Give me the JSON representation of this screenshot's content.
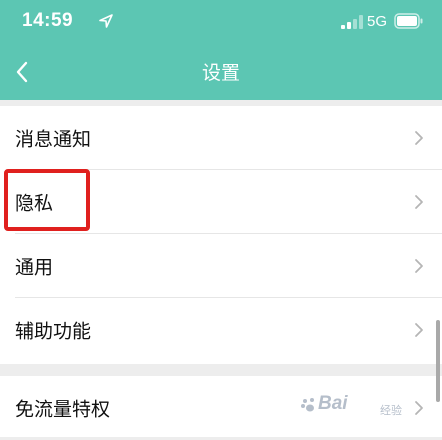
{
  "status_bar": {
    "time": "14:59",
    "network": "5G",
    "icons": [
      "location-arrow-icon",
      "signal-icon",
      "battery-icon"
    ]
  },
  "nav": {
    "title": "设置",
    "back_icon": "chevron-left-icon"
  },
  "settings": {
    "group1": [
      {
        "label": "消息通知"
      },
      {
        "label": "隐私"
      },
      {
        "label": "通用"
      },
      {
        "label": "辅助功能"
      }
    ],
    "group2": [
      {
        "label": "免流量特权"
      }
    ]
  },
  "watermark": {
    "text": "Bai",
    "sub": "经验"
  },
  "colors": {
    "header": "#5cc6b3",
    "highlight": "#e0201e",
    "background": "#ededed"
  }
}
